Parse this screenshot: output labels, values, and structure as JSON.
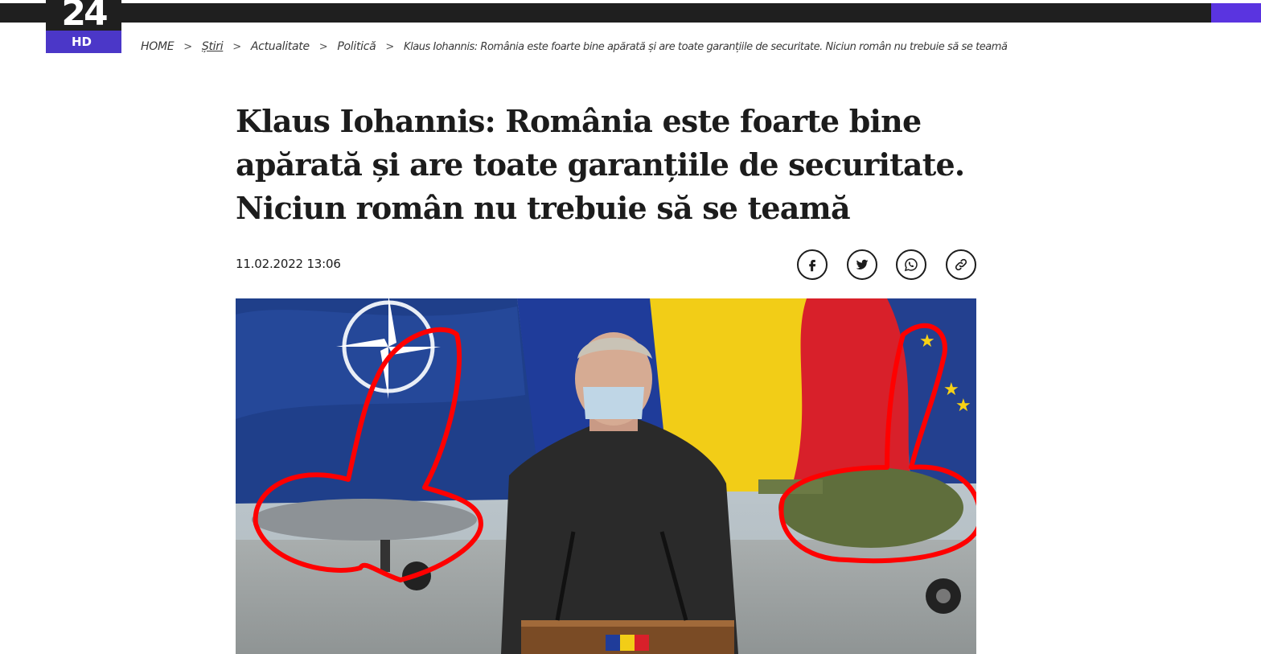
{
  "header": {
    "logo_number": "24",
    "logo_sub": "HD"
  },
  "breadcrumb": {
    "items": [
      "HOME",
      "Știri",
      "Actualitate",
      "Politică",
      "Klaus Iohannis: România este foarte bine apărată și are toate garanțiile de securitate. Niciun român nu trebuie să se teamă"
    ],
    "separator": ">"
  },
  "article": {
    "title_lines": [
      "Klaus Iohannis: România este foarte bine",
      "apărată și are toate garanțiile de securitate.",
      "Niciun român nu trebuie să se teamă"
    ],
    "date": "11.02.2022 13:06"
  },
  "share": {
    "icons": [
      "facebook-icon",
      "twitter-icon",
      "whatsapp-icon",
      "link-icon"
    ]
  },
  "colors": {
    "topbar": "#1f1f1f",
    "logo_accent": "#4b37c8",
    "corner_accent": "#5a34e0",
    "annotation": "#ff0000"
  }
}
